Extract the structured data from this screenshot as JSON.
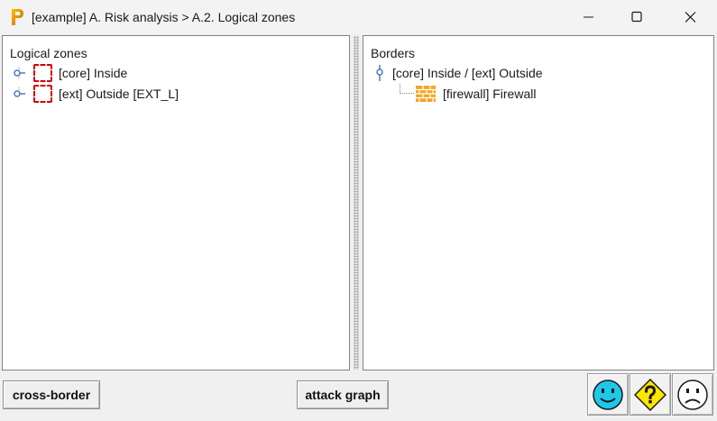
{
  "window": {
    "title": "[example] A. Risk analysis > A.2. Logical zones",
    "app_icon": "p-logo-icon",
    "controls": [
      "minimize-icon",
      "maximize-icon",
      "close-icon"
    ]
  },
  "left_panel": {
    "heading": "Logical zones",
    "items": [
      {
        "label": "[core] Inside",
        "icon": "zone-dashed-box-icon"
      },
      {
        "label": "[ext] Outside [EXT_L]",
        "icon": "zone-dashed-box-icon"
      }
    ]
  },
  "right_panel": {
    "heading": "Borders",
    "root": {
      "label": "[core] Inside / [ext] Outside"
    },
    "children": [
      {
        "label": "[firewall] Firewall",
        "icon": "firewall-brick-icon"
      }
    ]
  },
  "toolbar": {
    "cross_border_label": "cross-border",
    "attack_graph_label": "attack graph",
    "status_icons": [
      "happy-face-icon",
      "question-diamond-icon",
      "sad-face-icon"
    ]
  },
  "colors": {
    "zone_border": "#d40000",
    "firewall": "#f5a623",
    "happy_face": "#1ec8e8",
    "help_diamond": "#ffe600"
  }
}
